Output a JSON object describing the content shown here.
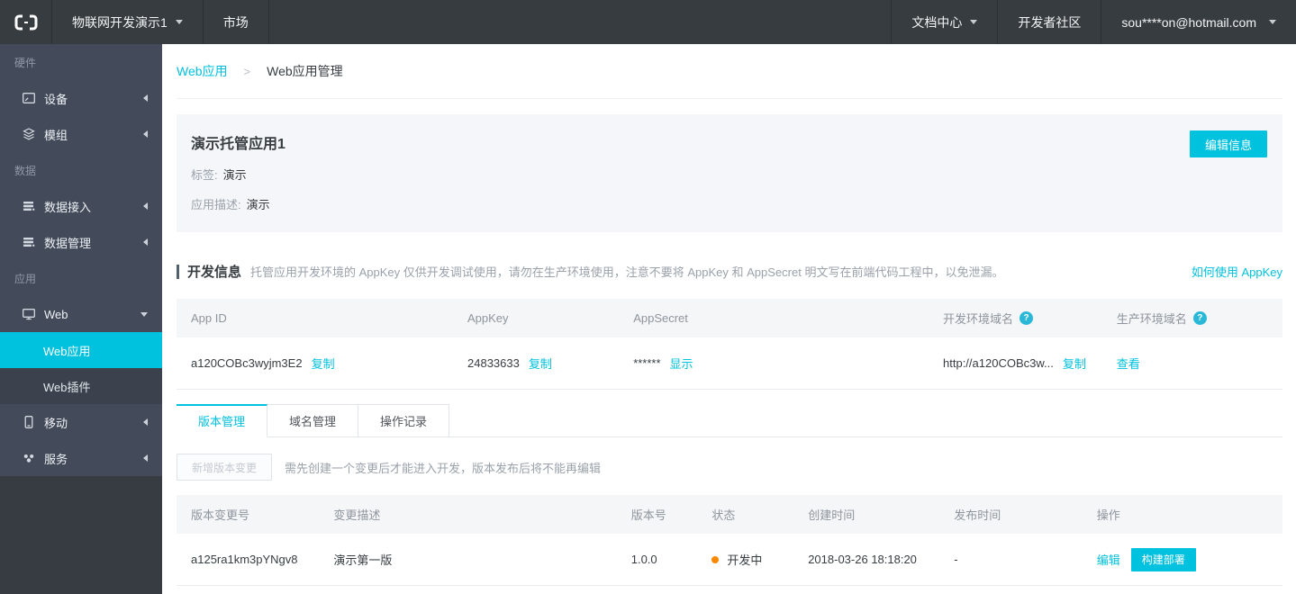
{
  "colors": {
    "accent": "#00c1de",
    "topbar_bg": "#373c41",
    "sidebar_bg": "#434b5a",
    "sidebar_submenu_bg": "#3b424e",
    "status_developing": "#ff8800"
  },
  "topbar": {
    "project_menu": "物联网开发演示1",
    "market": "市场",
    "doc_center": "文档中心",
    "developer_community": "开发者社区",
    "account_email": "sou****on@hotmail.com"
  },
  "sidebar": {
    "section_hardware": "硬件",
    "item_device": "设备",
    "item_module": "模组",
    "section_data": "数据",
    "item_data_access": "数据接入",
    "item_data_manage": "数据管理",
    "section_app": "应用",
    "item_web": "Web",
    "subitem_web_app": "Web应用",
    "subitem_web_plugin": "Web插件",
    "item_mobile": "移动",
    "item_service": "服务"
  },
  "breadcrumb": {
    "parent": "Web应用",
    "separator": ">",
    "current": "Web应用管理"
  },
  "app_card": {
    "title": "演示托管应用1",
    "tag_label": "标签:",
    "tag_value": "演示",
    "desc_label": "应用描述:",
    "desc_value": "演示",
    "edit_button": "编辑信息"
  },
  "dev_info": {
    "title": "开发信息",
    "description": "托管应用开发环境的 AppKey 仅供开发调试使用，请勿在生产环境使用，注意不要将 AppKey 和 AppSecret 明文写在前端代码工程中，以免泄漏。",
    "help_link": "如何使用 AppKey"
  },
  "app_table": {
    "headers": [
      "App ID",
      "AppKey",
      "AppSecret",
      "开发环境域名",
      "生产环境域名"
    ],
    "row": {
      "app_id": "a120COBc3wyjm3E2",
      "app_id_copy": "复制",
      "app_key": "24833633",
      "app_key_copy": "复制",
      "app_secret_masked": "******",
      "app_secret_show": "显示",
      "dev_domain": "http://a120COBc3w...",
      "dev_domain_copy": "复制",
      "prod_domain_view": "查看"
    }
  },
  "tabs": {
    "version_manage": "版本管理",
    "domain_manage": "域名管理",
    "operation_log": "操作记录"
  },
  "version_panel": {
    "add_button": "新增版本变更",
    "hint": "需先创建一个变更后才能进入开发，版本发布后将不能再编辑"
  },
  "version_table": {
    "headers": [
      "版本变更号",
      "变更描述",
      "版本号",
      "状态",
      "创建时间",
      "发布时间",
      "操作"
    ],
    "row": {
      "change_id": "a125ra1km3pYNgv8",
      "description": "演示第一版",
      "version": "1.0.0",
      "status": "开发中",
      "created_at": "2018-03-26 18:18:20",
      "published_at": "-",
      "edit_link": "编辑",
      "deploy_button": "构建部署"
    }
  }
}
